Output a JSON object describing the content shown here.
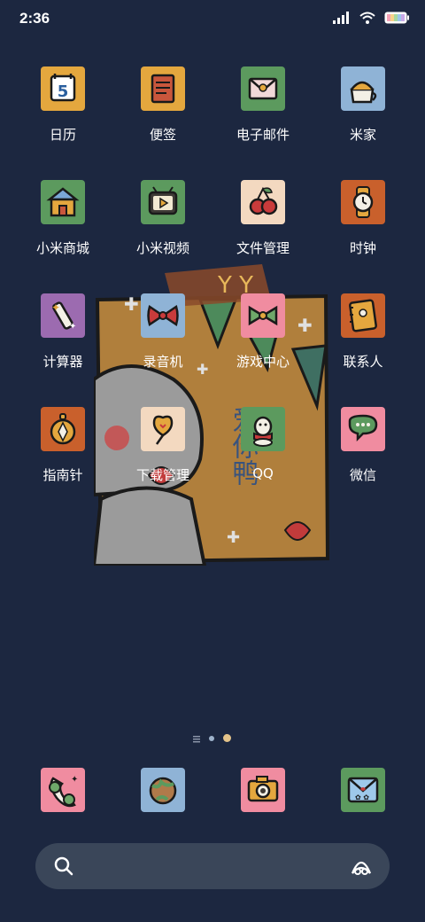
{
  "status_bar": {
    "time": "2:36"
  },
  "apps": {
    "calendar": {
      "label": "日历",
      "day": "5"
    },
    "notes": {
      "label": "便签"
    },
    "email": {
      "label": "电子邮件"
    },
    "mijia": {
      "label": "米家"
    },
    "mi_store": {
      "label": "小米商城"
    },
    "mi_video": {
      "label": "小米视频"
    },
    "file_manager": {
      "label": "文件管理"
    },
    "clock": {
      "label": "时钟"
    },
    "calculator": {
      "label": "计算器"
    },
    "recorder": {
      "label": "录音机"
    },
    "game_center": {
      "label": "游戏中心"
    },
    "contacts": {
      "label": "联系人"
    },
    "compass": {
      "label": "指南针"
    },
    "downloads": {
      "label": "下载管理"
    },
    "qq": {
      "label": "QQ"
    },
    "wechat": {
      "label": "微信"
    }
  },
  "widget": {
    "text": "爱你鸭"
  },
  "colors": {
    "background": "#1c2740",
    "search_bar": "#3a4659"
  }
}
